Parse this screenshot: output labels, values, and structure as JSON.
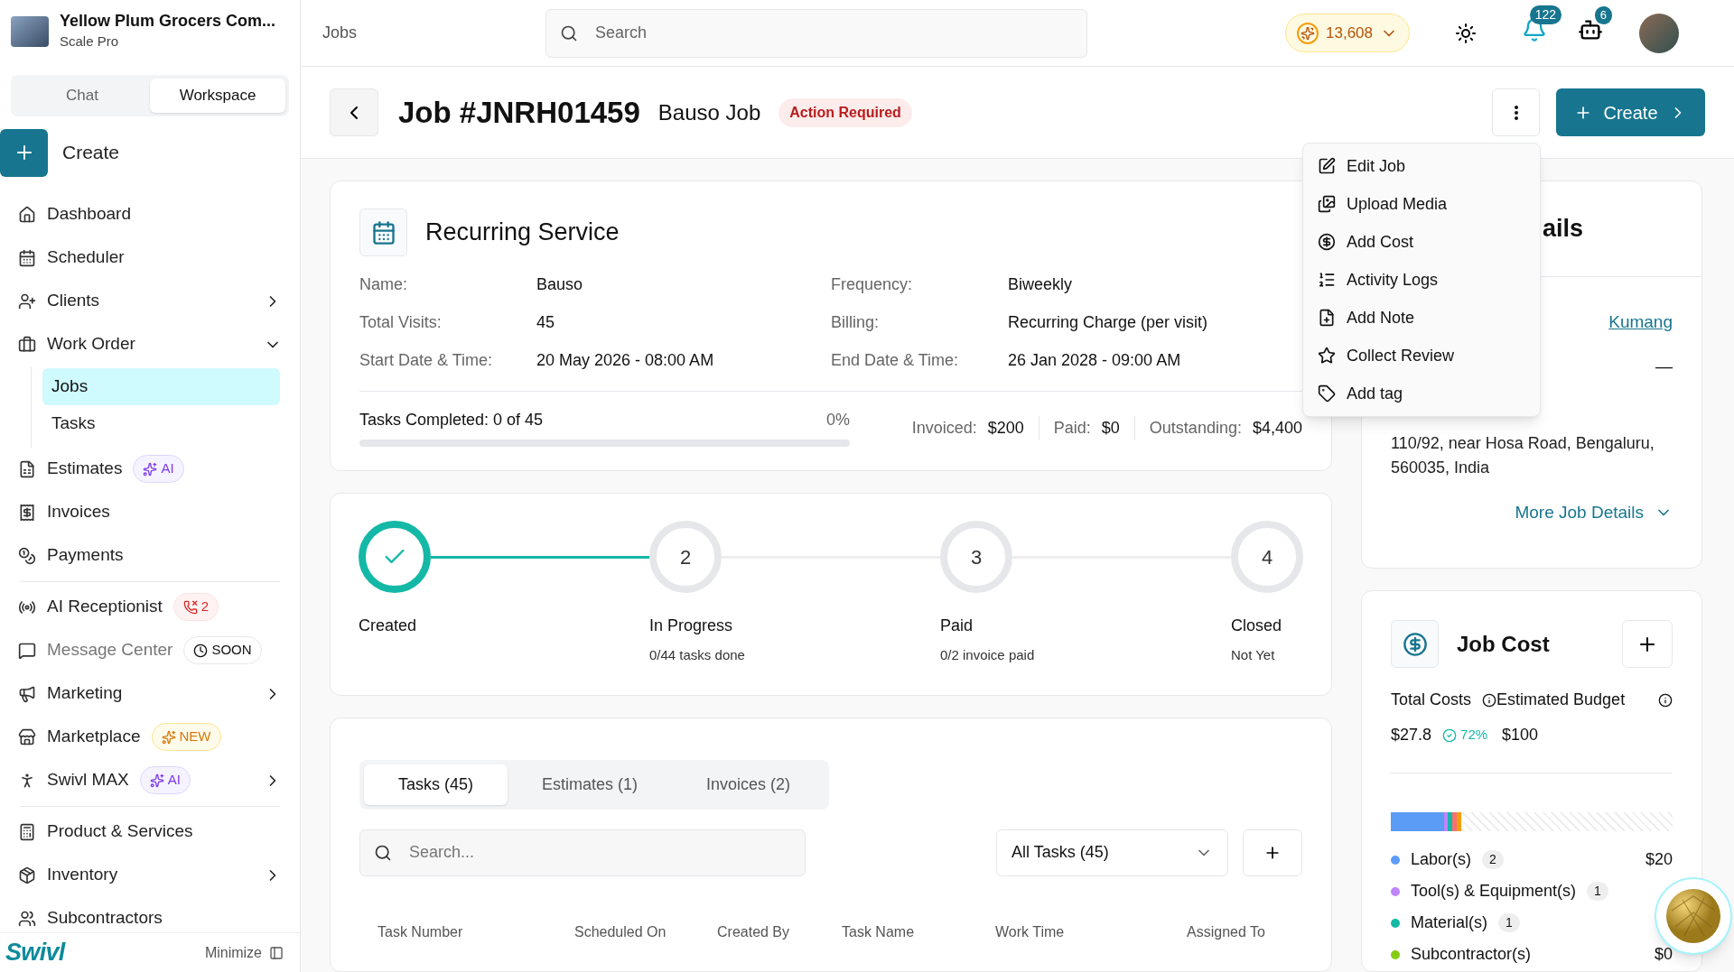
{
  "org": {
    "name": "Yellow Plum Grocers Com...",
    "plan": "Scale Pro"
  },
  "mode_tabs": [
    {
      "label": "Chat",
      "selected": false
    },
    {
      "label": "Workspace",
      "selected": true
    }
  ],
  "create_label": "Create",
  "sidebar": {
    "items": [
      {
        "kind": "home",
        "label": "Dashboard",
        "has_submenu": false
      },
      {
        "kind": "calendar",
        "label": "Scheduler",
        "has_submenu": false
      },
      {
        "kind": "clients",
        "label": "Clients",
        "has_submenu": true,
        "expanded": false
      },
      {
        "kind": "briefcase",
        "label": "Work Order",
        "has_submenu": true,
        "expanded": true,
        "children": [
          {
            "label": "Jobs",
            "selected": true
          },
          {
            "label": "Tasks",
            "selected": false
          }
        ]
      },
      {
        "kind": "file",
        "label": "Estimates",
        "has_submenu": false,
        "badge": {
          "text": "AI",
          "kind": "ai"
        }
      },
      {
        "kind": "dollar",
        "label": "Invoices",
        "has_submenu": false
      },
      {
        "kind": "coins",
        "label": "Payments",
        "has_submenu": false,
        "divider_after": true
      },
      {
        "kind": "receptionist",
        "label": "AI Receptionist",
        "has_submenu": false,
        "badge": {
          "text": "2",
          "kind": "calls"
        }
      },
      {
        "kind": "message",
        "label": "Message Center",
        "has_submenu": false,
        "disabled": true,
        "badge": {
          "text": "SOON",
          "kind": "soon"
        }
      },
      {
        "kind": "megaphone",
        "label": "Marketing",
        "has_submenu": true,
        "expanded": false
      },
      {
        "kind": "store",
        "label": "Marketplace",
        "has_submenu": false,
        "badge": {
          "text": "NEW",
          "kind": "new"
        }
      },
      {
        "kind": "person",
        "label": "Swivl MAX",
        "has_submenu": true,
        "expanded": false,
        "badge": {
          "text": "AI",
          "kind": "ai"
        },
        "divider_after": true
      },
      {
        "kind": "calculator",
        "label": "Product & Services",
        "has_submenu": false
      },
      {
        "kind": "box",
        "label": "Inventory",
        "has_submenu": true,
        "expanded": false
      },
      {
        "kind": "contractor",
        "label": "Subcontractors",
        "has_submenu": false
      }
    ]
  },
  "brand": "Swivl",
  "minimize_label": "Minimize",
  "topbar": {
    "breadcrumb": "Jobs",
    "search_placeholder": "Search",
    "credits": "13,608",
    "notifications": "122",
    "messages": "6"
  },
  "job": {
    "title": "Job #JNRH01459",
    "name": "Bauso Job",
    "status": "Action Required",
    "create_label": "Create"
  },
  "menu": {
    "open": true,
    "items": [
      {
        "kind": "edit",
        "label": "Edit Job"
      },
      {
        "kind": "media",
        "label": "Upload Media"
      },
      {
        "kind": "cost",
        "label": "Add Cost"
      },
      {
        "kind": "logs",
        "label": "Activity Logs"
      },
      {
        "kind": "note",
        "label": "Add Note"
      },
      {
        "kind": "review",
        "label": "Collect Review"
      },
      {
        "kind": "tag",
        "label": "Add tag"
      }
    ]
  },
  "recurring": {
    "title": "Recurring Service",
    "fields": [
      {
        "label": "Name:",
        "value": "Bauso"
      },
      {
        "label": "Frequency:",
        "value": "Biweekly"
      },
      {
        "label": "Total Visits:",
        "value": "45"
      },
      {
        "label": "Billing:",
        "value": "Recurring Charge (per visit)"
      },
      {
        "label": "Start Date & Time:",
        "value": "20 May 2026 - 08:00 AM"
      },
      {
        "label": "End Date & Time:",
        "value": "26 Jan 2028 - 09:00 AM"
      }
    ],
    "tasks_completed": "Tasks Completed: 0 of 45",
    "percent": "0%",
    "level": 0,
    "totals": [
      {
        "label": "Invoiced:",
        "value": "$200"
      },
      {
        "label": "Paid:",
        "value": "$0"
      },
      {
        "label": "Outstanding:",
        "value": "$4,400"
      }
    ]
  },
  "stepper": [
    {
      "label": "Created",
      "done": true
    },
    {
      "number": "2",
      "label": "In Progress",
      "note": "0/44 tasks done",
      "done": false
    },
    {
      "number": "3",
      "label": "Paid",
      "note": "0/2 invoice paid",
      "done": false
    },
    {
      "number": "4",
      "label": "Closed",
      "note": "Not Yet",
      "done": false
    }
  ],
  "tabs": [
    {
      "label": "Tasks (45)",
      "selected": true
    },
    {
      "label": "Estimates (1)",
      "selected": false
    },
    {
      "label": "Invoices (2)",
      "selected": false
    }
  ],
  "task_search_placeholder": "Search...",
  "task_filter": "All Tasks (45)",
  "table": {
    "columns": [
      "Task Number",
      "Scheduled On",
      "Created By",
      "Task Name",
      "Work Time",
      "Assigned To"
    ]
  },
  "details": {
    "title_visible": "ails",
    "client_link": "Kumang",
    "dash": "—",
    "address": "110/92, near Hosa Road, Bengaluru, 560035, India",
    "more": "More Job Details"
  },
  "job_cost": {
    "title": "Job Cost",
    "total_label": "Total Costs",
    "budget_label": "Estimated Budget",
    "total": "$27.8",
    "percent": "72%",
    "budget": "$100",
    "cost_bar": {
      "segments": [
        {
          "color": "#5b9cf6"
        },
        {
          "color": "#c084fc"
        },
        {
          "color": "#14b8a6"
        },
        {
          "color": "#f87171"
        },
        {
          "color": "#f59e0b"
        }
      ]
    },
    "items": [
      {
        "label": "Labor(s)",
        "count": "2",
        "color": "#5b9cf6",
        "amount": "$20"
      },
      {
        "label": "Tool(s) & Equipment(s)",
        "count": "1",
        "color": "#c084fc"
      },
      {
        "label": "Material(s)",
        "count": "1",
        "color": "#14b8a6"
      },
      {
        "label": "Subcontractor(s)",
        "color": "#84cc16",
        "amount": "$0"
      }
    ]
  }
}
